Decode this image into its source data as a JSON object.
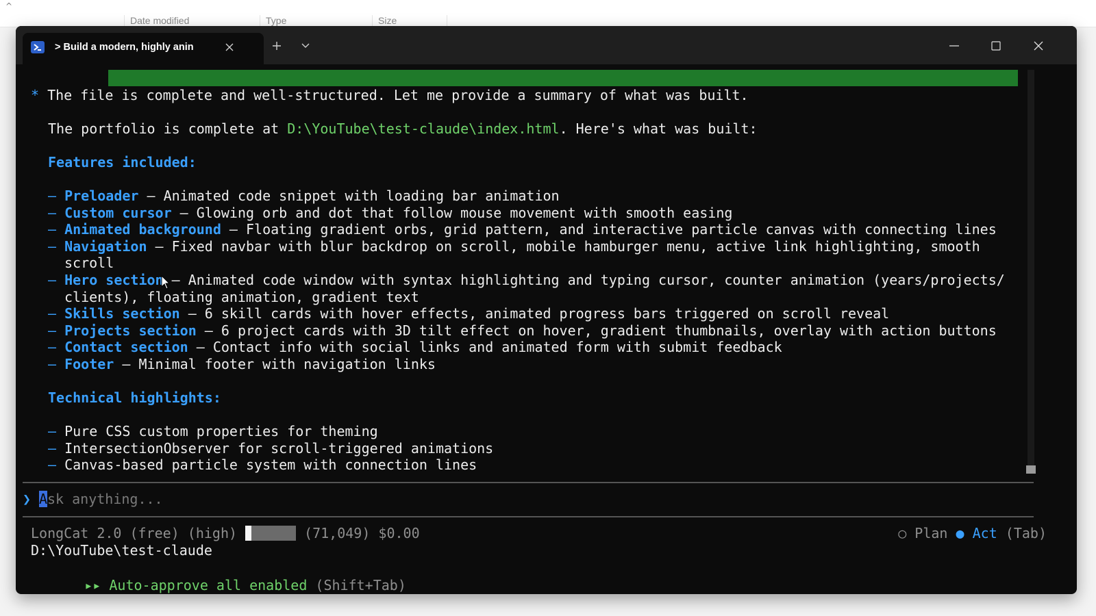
{
  "explorer": {
    "columns": [
      "Date modified",
      "Type",
      "Size"
    ]
  },
  "window": {
    "tab_title": "> Build a modern, highly anin",
    "icons": {
      "tab": "powershell-icon",
      "close_tab": "close-icon",
      "new_tab": "plus-icon",
      "dropdown": "chevron-down-icon",
      "minimize": "minimize-icon",
      "maximize": "maximize-icon",
      "close": "close-icon"
    }
  },
  "output": {
    "intro_star": "*",
    "intro": "The file is complete and well-structured. Let me provide a summary of what was built.",
    "portfolio_prefix": "The portfolio is complete at ",
    "portfolio_path": "D:\\YouTube\\test-claude\\index.html",
    "portfolio_suffix": ". Here's what was built:",
    "features_heading": "Features included:",
    "features": [
      {
        "name": "Preloader",
        "desc": " – Animated code snippet with loading bar animation",
        "cont": ""
      },
      {
        "name": "Custom cursor",
        "desc": " – Glowing orb and dot that follow mouse movement with smooth easing",
        "cont": ""
      },
      {
        "name": "Animated background",
        "desc": " – Floating gradient orbs, grid pattern, and interactive particle canvas with connecting lines",
        "cont": ""
      },
      {
        "name": "Navigation",
        "desc": " – Fixed navbar with blur backdrop on scroll, mobile hamburger menu, active link highlighting, smooth",
        "cont": "scroll"
      },
      {
        "name": "Hero section",
        "desc": " – Animated code window with syntax highlighting and typing cursor, counter animation (years/projects/",
        "cont": "clients), floating animation, gradient text"
      },
      {
        "name": "Skills section",
        "desc": " – 6 skill cards with hover effects, animated progress bars triggered on scroll reveal",
        "cont": ""
      },
      {
        "name": "Projects section",
        "desc": " – 6 project cards with 3D tilt effect on hover, gradient thumbnails, overlay with action buttons",
        "cont": ""
      },
      {
        "name": "Contact section",
        "desc": " – Contact info with social links and animated form with submit feedback",
        "cont": ""
      },
      {
        "name": "Footer",
        "desc": " – Minimal footer with navigation links",
        "cont": ""
      }
    ],
    "tech_heading": "Technical highlights:",
    "tech": [
      "Pure CSS custom properties for theming",
      "IntersectionObserver for scroll-triggered animations",
      "Canvas-based particle system with connection lines"
    ],
    "dash": "–"
  },
  "input": {
    "chevron": "❯",
    "caret_char": "A",
    "placeholder_rest": "sk anything..."
  },
  "status": {
    "model": "LongCat 2.0 (free) (high)",
    "tokens": "(71,049)",
    "cost": "$0.00",
    "context_fill": 0.12,
    "plan_marker": "○",
    "plan": "Plan",
    "act_marker": "●",
    "act": "Act",
    "mode_hint": "(Tab)",
    "cwd": "D:\\YouTube\\test-claude",
    "auto_icon": "▸▸",
    "auto_text": "Auto-approve all enabled",
    "auto_hint": "(Shift+Tab)"
  },
  "colors": {
    "accent": "#3aa0ff",
    "path_green": "#6fd26a",
    "progress_green": "#1f7a2a",
    "terminal_bg": "#0c0c0c"
  }
}
